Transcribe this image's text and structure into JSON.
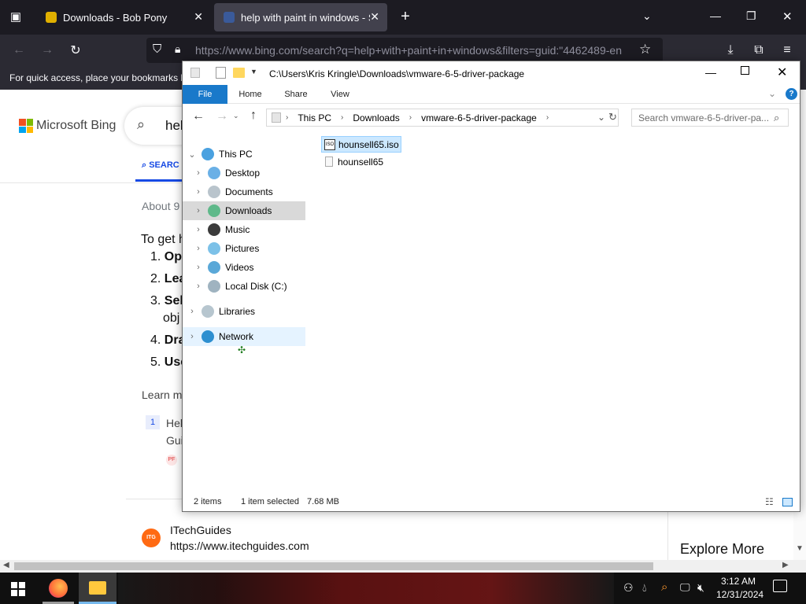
{
  "browser": {
    "tabs": [
      {
        "label": "Downloads - Bob Pony",
        "active": false
      },
      {
        "label": "help with paint in windows - Se",
        "active": true
      }
    ],
    "url": "https://www.bing.com/search?q=help+with+paint+in+windows&filters=guid:\"4462489-en",
    "bookmarks_text": "For quick access, place your bookmarks h"
  },
  "bing": {
    "logo": "Microsoft Bing",
    "query_partial": "hel",
    "search_tab": "SEARC",
    "results_count_partial": "About 9",
    "answer_intro": "To get h",
    "steps": [
      "Ope",
      "Lea",
      "Sele",
      "Dra",
      "Use"
    ],
    "step3_cont": "obj",
    "learn_more": "Learn m",
    "cite_num": "1",
    "cite_text1": "Hel",
    "cite_text2": "Gui",
    "source_name": "ITechGuides",
    "source_url": "https://www.itechguides.com",
    "source_icon": "ITG",
    "explore_more": "Explore More"
  },
  "explorer": {
    "title_path": "C:\\Users\\Kris Kringle\\Downloads\\vmware-6-5-driver-package",
    "ribbon_tabs": [
      "File",
      "Home",
      "Share",
      "View"
    ],
    "breadcrumb": [
      "This PC",
      "Downloads",
      "vmware-6-5-driver-package"
    ],
    "search_placeholder": "Search vmware-6-5-driver-pa...",
    "nav": {
      "this_pc": "This PC",
      "children": [
        "Desktop",
        "Documents",
        "Downloads",
        "Music",
        "Pictures",
        "Videos",
        "Local Disk (C:)"
      ],
      "libraries": "Libraries",
      "network": "Network"
    },
    "files": [
      {
        "name": "hounsell65.iso",
        "selected": true,
        "icon": "iso-file-icon"
      },
      {
        "name": "hounsell65",
        "selected": false,
        "icon": "blank-file-icon"
      }
    ],
    "status": {
      "count": "2 items",
      "selected": "1 item selected",
      "size": "7.68 MB"
    }
  },
  "taskbar": {
    "time": "3:12 AM",
    "date": "12/31/2024"
  },
  "colors": {
    "accent": "#0078d7",
    "selection": "#cce8ff",
    "ff_bg": "#1c1b22"
  }
}
